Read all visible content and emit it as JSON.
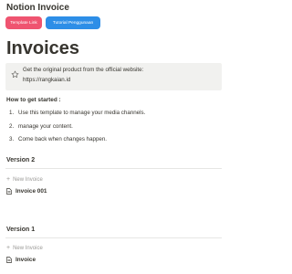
{
  "header": {
    "app_title": "Notion Invoice",
    "buttons": [
      {
        "label": "Template Link",
        "color": "#ef5470"
      },
      {
        "label": "Tutorial Penggunaan",
        "color": "#2d8ee7"
      }
    ]
  },
  "page": {
    "title": "Invoices",
    "callout": {
      "icon": "star-icon",
      "line1": "Get the original product from the official website:",
      "line2": "https://rangkaian.id"
    },
    "how_to": {
      "heading": "How to get started :",
      "steps": [
        {
          "num": "1.",
          "text": "Use this template to manage your media channels."
        },
        {
          "num": "2.",
          "text": "manage your content."
        },
        {
          "num": "3.",
          "text": "Come back when changes happen."
        }
      ]
    },
    "versions": [
      {
        "heading": "Version 2",
        "new_label": "New Invoice",
        "items": [
          {
            "label": "Invoice 001",
            "icon": "document-icon"
          }
        ]
      },
      {
        "heading": "Version 1",
        "new_label": "New Invoice",
        "items": [
          {
            "label": "Invoice",
            "icon": "document-icon"
          }
        ]
      }
    ]
  }
}
